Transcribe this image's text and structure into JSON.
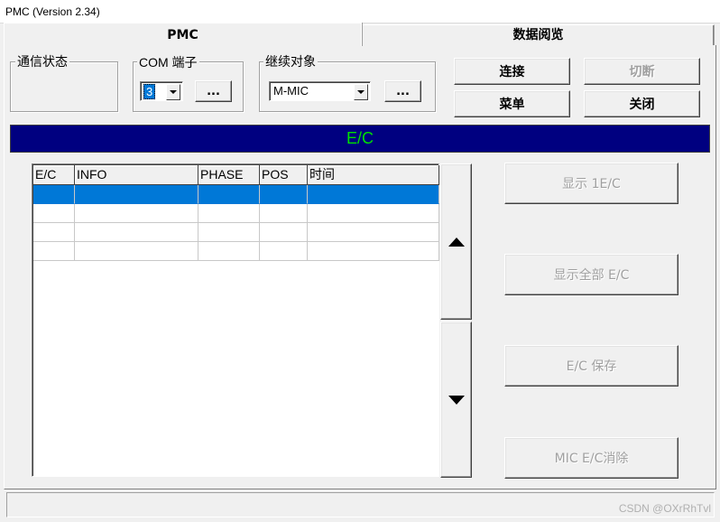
{
  "window": {
    "title": "PMC (Version 2.34)"
  },
  "tabs": [
    {
      "label": "PMC",
      "active": true
    },
    {
      "label": "数据阅览",
      "active": false
    }
  ],
  "comm_status": {
    "title": "通信状态"
  },
  "com_port": {
    "title": "COM 端子",
    "value": "3",
    "browse_label": "..."
  },
  "target": {
    "title": "继续对象",
    "value": "M-MIC",
    "browse_label": "..."
  },
  "buttons": {
    "connect": "连接",
    "disconnect": "切断",
    "menu": "菜单",
    "close": "关闭"
  },
  "banner": {
    "text": "E/C",
    "bg_color": "#000080",
    "text_color": "#00e000"
  },
  "table": {
    "columns": [
      "E/C",
      "INFO",
      "PHASE",
      "POS",
      "时间"
    ],
    "rows": [
      {
        "selected": true,
        "cells": [
          "",
          "",
          "",
          "",
          ""
        ]
      },
      {
        "selected": false,
        "cells": [
          "",
          "",
          "",
          "",
          ""
        ]
      },
      {
        "selected": false,
        "cells": [
          "",
          "",
          "",
          "",
          ""
        ]
      },
      {
        "selected": false,
        "cells": [
          "",
          "",
          "",
          "",
          ""
        ]
      }
    ]
  },
  "scroll": {
    "up_icon": "triangle-up-icon",
    "down_icon": "triangle-down-icon"
  },
  "actions": {
    "show_one": "显示 1E/C",
    "show_all": "显示全部 E/C",
    "save": "E/C 保存",
    "clear": "MIC E/C消除"
  },
  "watermark": "CSDN @OXrRhTvl"
}
